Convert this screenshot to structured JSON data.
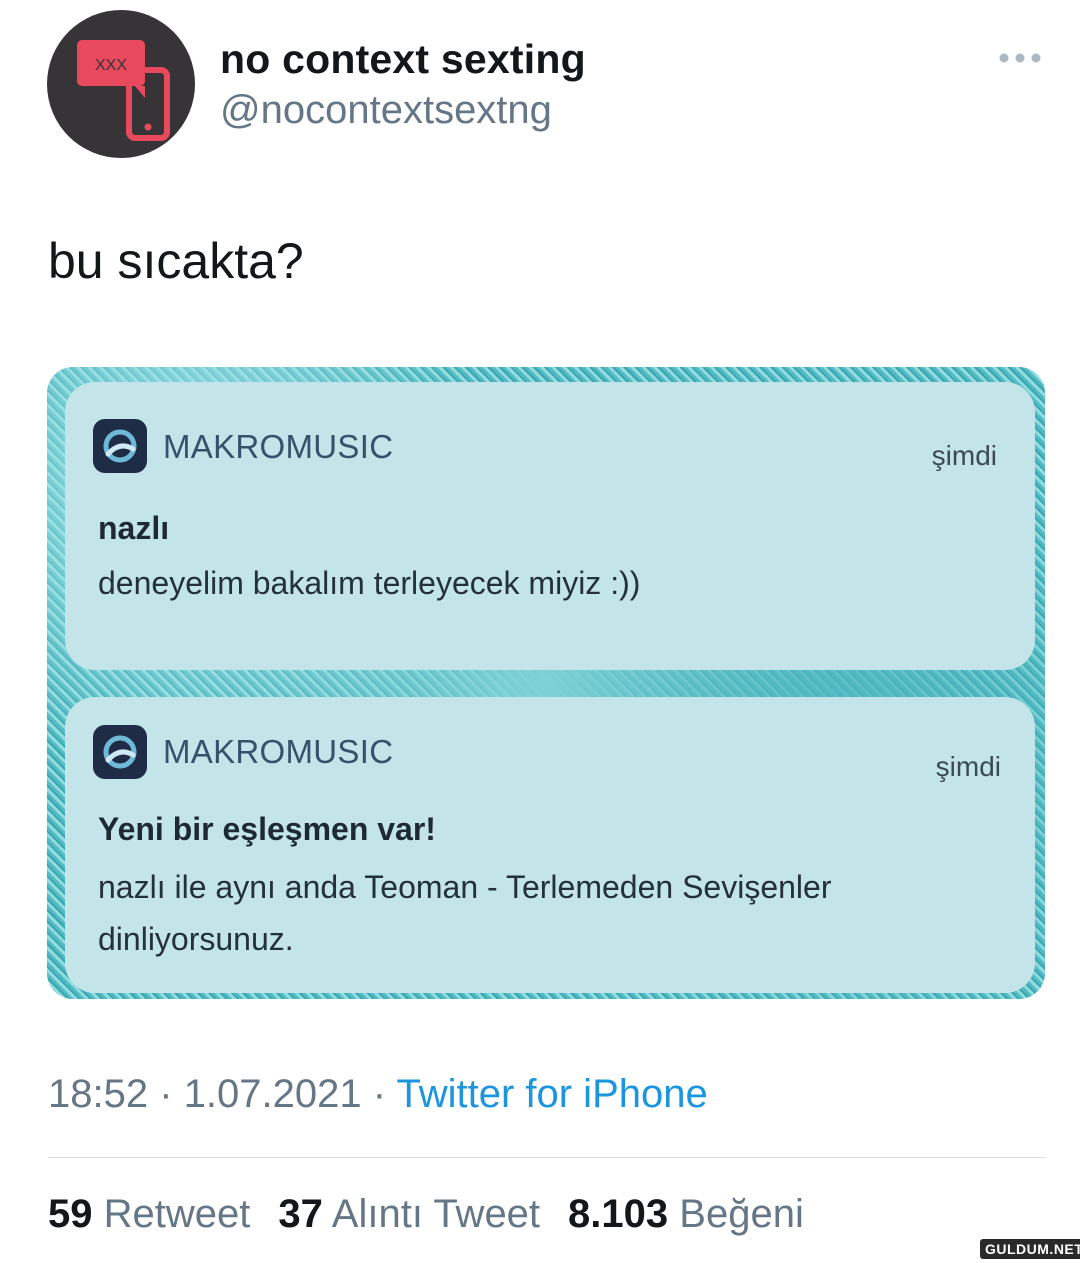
{
  "author": {
    "display_name": "no context sexting",
    "handle": "@nocontextsextng",
    "avatar_badge_text": "XXX",
    "avatar_icon": "phone-chat-icon",
    "avatar_accent": "#e8495c"
  },
  "more_icon": "ellipsis-icon",
  "tweet": {
    "text": "bu sıcakta?"
  },
  "media": {
    "notifications": [
      {
        "app_name": "MAKROMUSIC",
        "time": "şimdi",
        "title": "nazlı",
        "body": "deneyelim bakalım terleyecek miyiz :))"
      },
      {
        "app_name": "MAKROMUSIC",
        "time": "şimdi",
        "title": "Yeni bir eşleşmen var!",
        "body": "nazlı ile aynı anda Teoman - Terlemeden Sevişenler dinliyorsunuz."
      }
    ]
  },
  "meta": {
    "time": "18:52",
    "separator": "·",
    "date": "1.07.2021",
    "source": "Twitter for iPhone"
  },
  "stats": {
    "retweets_count": "59",
    "retweets_label": "Retweet",
    "quotes_count": "37",
    "quotes_label": "Alıntı Tweet",
    "likes_count": "8.103",
    "likes_label": "Beğeni"
  },
  "watermark": "GULDUM.NET"
}
